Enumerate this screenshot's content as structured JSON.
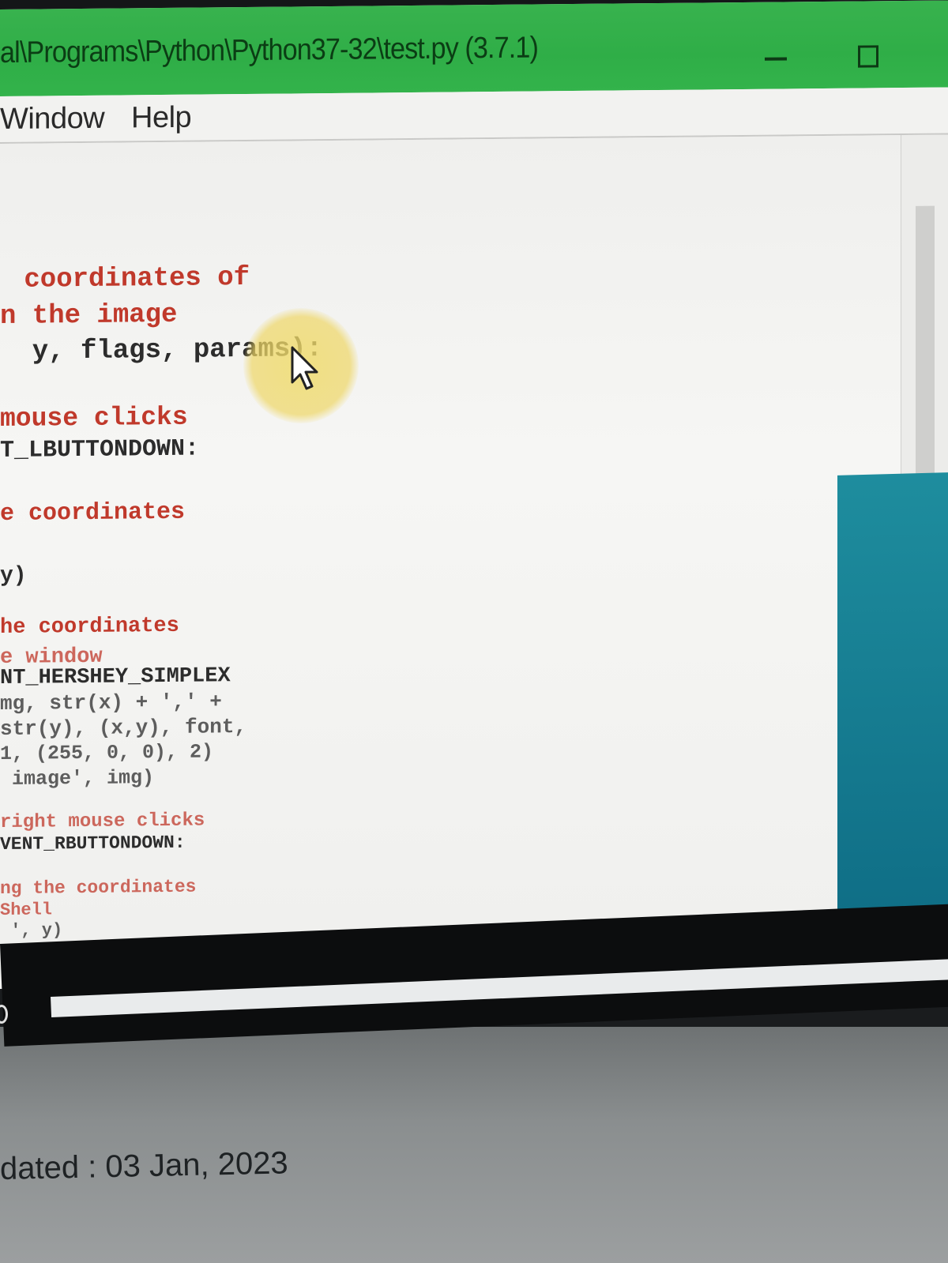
{
  "window": {
    "title": "al\\Programs\\Python\\Python37-32\\test.py (3.7.1)"
  },
  "menu": {
    "window_label": "Window",
    "help_label": "Help"
  },
  "code": [
    {
      "text": " coordinates of",
      "kind": "comment"
    },
    {
      "text": "n the image",
      "kind": "comment"
    },
    {
      "text": "  y, flags, params):",
      "kind": "code"
    },
    {
      "text": "mouse clicks",
      "kind": "comment"
    },
    {
      "text": "T_LBUTTONDOWN:",
      "kind": "code"
    },
    {
      "text": "e coordinates",
      "kind": "comment"
    },
    {
      "text": "y)",
      "kind": "code"
    },
    {
      "text": "he coordinates",
      "kind": "comment"
    },
    {
      "text": "e window",
      "kind": "comment"
    },
    {
      "text": "NT_HERSHEY_SIMPLEX",
      "kind": "code"
    },
    {
      "text": "mg, str(x) + ',' +",
      "kind": "code"
    },
    {
      "text": "str(y), (x,y), font,",
      "kind": "code"
    },
    {
      "text": "1, (255, 0, 0), 2)",
      "kind": "code"
    },
    {
      "text": " image', img)",
      "kind": "code"
    },
    {
      "text": "right mouse clicks",
      "kind": "comment"
    },
    {
      "text": "VENT_RBUTTONDOWN:",
      "kind": "code"
    },
    {
      "text": "ng the coordinates",
      "kind": "comment"
    },
    {
      "text": "Shell",
      "kind": "comment"
    },
    {
      "text": " ', y)",
      "kind": "code"
    }
  ],
  "footer": {
    "updated": "dated : 03 Jan, 2023"
  },
  "colors": {
    "titlebar": "#33b34b",
    "comment": "#c0392b",
    "code": "#2c2c2c",
    "cursor_halo": "#eed664"
  },
  "icons": {
    "pointer": "mouse-pointer-icon",
    "minimize": "minimize-icon",
    "maximize": "maximize-icon"
  }
}
